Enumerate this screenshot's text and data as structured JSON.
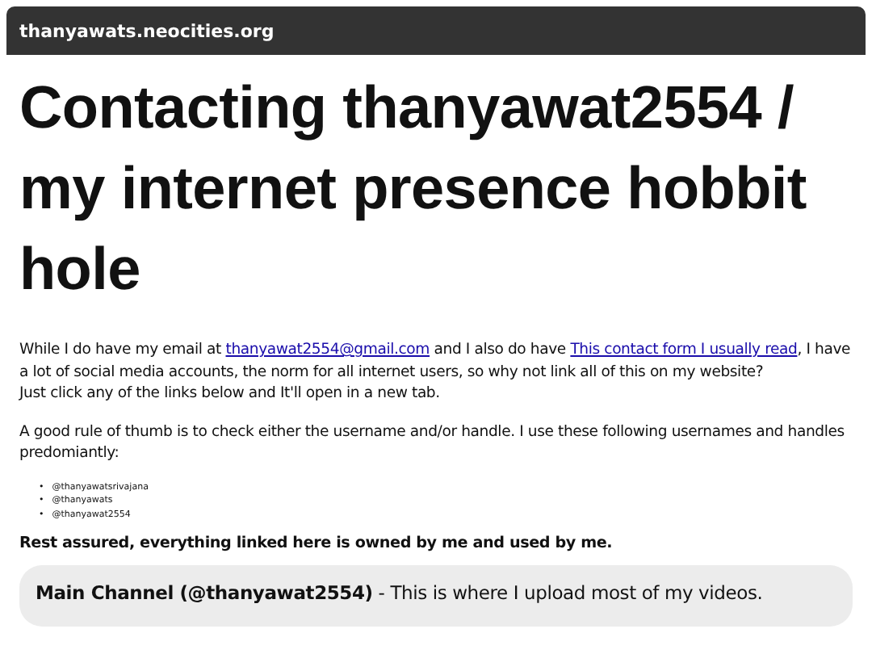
{
  "address_bar": {
    "text": "thanyawats.neocities.org"
  },
  "heading": "Contacting thanyawat2554 / my internet presence hobbit hole",
  "intro": {
    "before": "While I do have my email at ",
    "email_link": "thanyawat2554@gmail.com",
    "middle": " and I also do have ",
    "form_link": "This contact form I usually read",
    "after": ", I have a lot of social media accounts, the norm for all internet users, so why not link all of this on my website?",
    "second_line": "Just click any of the links below and It'll open in a new tab."
  },
  "rule_text": "A good rule of thumb is to check either the username and/or handle. I use these following usernames and handles predomiantly:",
  "bullet": "•",
  "handles": [
    "@thanyawatsrivajana",
    "@thanyawats",
    "@thanyawat2554"
  ],
  "assurance": "Rest assured, everything linked here is owned by me and used by me.",
  "links": [
    {
      "text": "**Main Channel (@thanyawat2554)** - This is where I upload most of my videos."
    }
  ]
}
